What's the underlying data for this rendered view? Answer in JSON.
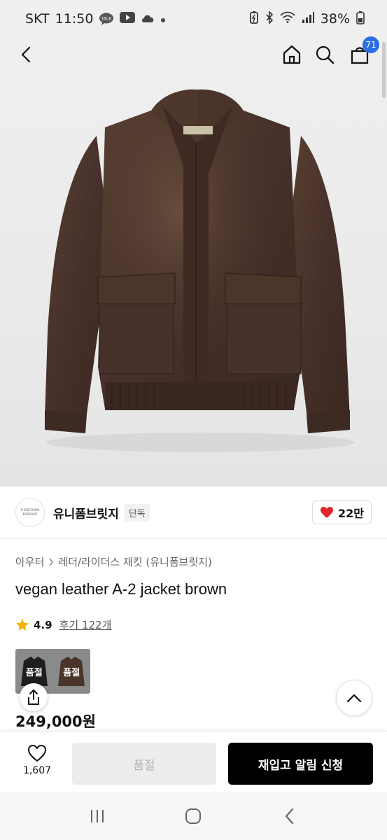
{
  "status_bar": {
    "carrier": "SKT",
    "time": "11:50",
    "talk_badge": "TALK",
    "battery": "38%"
  },
  "header": {
    "cart_count": "71"
  },
  "brand": {
    "logo_text": "UNIFORM BRIDGE",
    "name": "유니폼브릿지",
    "tag": "단독",
    "likes": "22만"
  },
  "breadcrumb": {
    "category": "아우터",
    "subcategory": "레더/라이더스 재킷 (유니폼브릿지)"
  },
  "product": {
    "title": "vegan leather A-2 jacket brown",
    "rating": "4.9",
    "reviews": "후기 122개",
    "price": "249,000원"
  },
  "options": [
    {
      "label": "품절",
      "color": "#1e1e1e"
    },
    {
      "label": "품절",
      "color": "#4a3528"
    }
  ],
  "actions": {
    "wish_count": "1,607",
    "soldout_label": "품절",
    "restock_label": "재입고 알림 신청"
  },
  "colors": {
    "accent_blue": "#2b6fe4",
    "heart_red": "#e0252b",
    "star_yellow": "#f5b301",
    "jacket_brown": "#4a3327"
  }
}
